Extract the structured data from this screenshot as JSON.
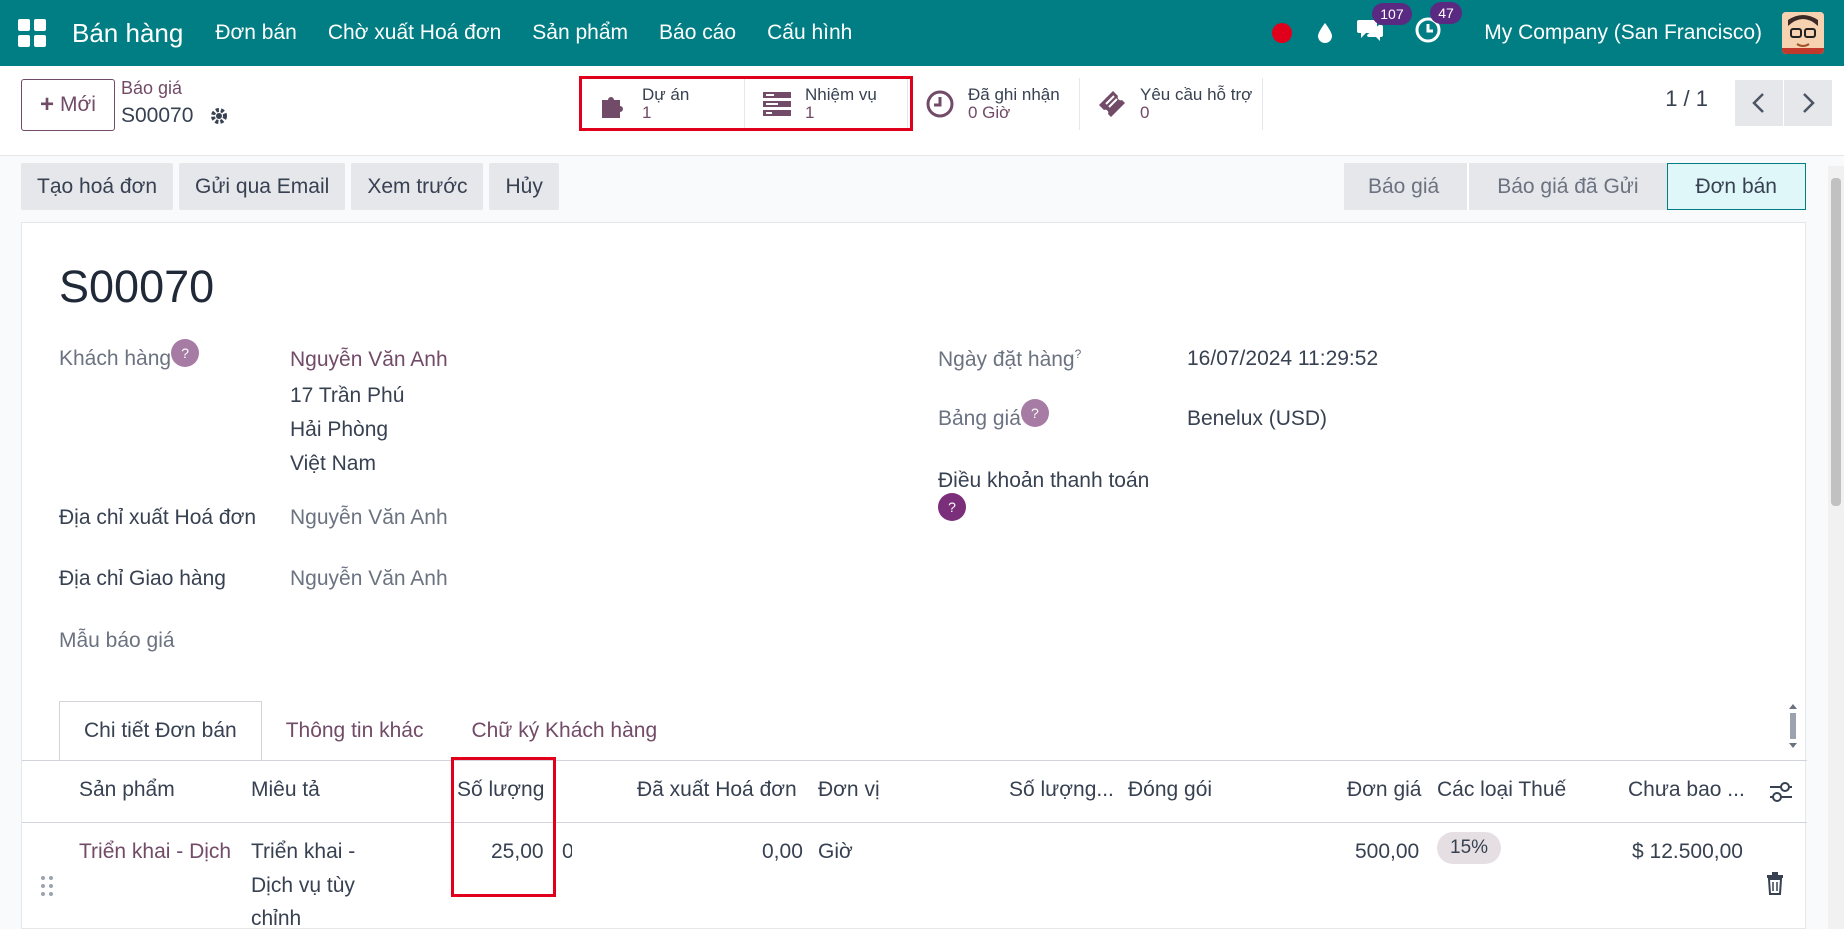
{
  "nav": {
    "app_name": "Bán hàng",
    "menu": [
      "Đơn bán",
      "Chờ xuất Hoá đơn",
      "Sản phẩm",
      "Báo cáo",
      "Cấu hình"
    ],
    "messages_count": "107",
    "activities_count": "47",
    "company": "My Company (San Francisco)"
  },
  "control": {
    "new_label": "Mới",
    "breadcrumb_parent": "Báo giá",
    "breadcrumb_current": "S00070",
    "pager": "1 / 1"
  },
  "smart_buttons": [
    {
      "label": "Dự án",
      "value": "1",
      "icon": "puzzle-icon"
    },
    {
      "label": "Nhiệm vụ",
      "value": "1",
      "icon": "tasks-icon"
    },
    {
      "label": "Đã ghi nhận",
      "value": "0 Giờ",
      "icon": "clock-icon"
    },
    {
      "label": "Yêu cầu hỗ trợ",
      "value": "0",
      "icon": "ticket-icon"
    }
  ],
  "actions": [
    "Tạo hoá đơn",
    "Gửi qua Email",
    "Xem trước",
    "Hủy"
  ],
  "stages": [
    "Báo giá",
    "Báo giá đã Gửi",
    "Đơn bán"
  ],
  "form": {
    "name": "S00070",
    "customer_label": "Khách hàng",
    "customer_name": "Nguyễn Văn Anh",
    "customer_address": [
      "17 Trần Phú",
      "Hải Phòng",
      "Việt Nam"
    ],
    "invoice_address_label": "Địa chỉ xuất Hoá đơn",
    "invoice_address": "Nguyễn Văn Anh",
    "delivery_address_label": "Địa chỉ Giao hàng",
    "delivery_address": "Nguyễn Văn Anh",
    "template_label": "Mẫu báo giá",
    "order_date_label": "Ngày đặt hàng",
    "order_date_sup": "?",
    "order_date": "16/07/2024 11:29:52",
    "pricelist_label": "Bảng giá",
    "pricelist": "Benelux (USD)",
    "payment_terms_label": "Điều khoản thanh toán",
    "help_glyph": "?"
  },
  "tabs": [
    "Chi tiết Đơn bán",
    "Thông tin khác",
    "Chữ ký Khách hàng"
  ],
  "table": {
    "headers": [
      "Sản phẩm",
      "Miêu tả",
      "Số lượng",
      "Đã xuất Hoá đơn",
      "Đơn vị",
      "Số lượng...",
      "Đóng gói",
      "Đơn giá",
      "Các loại Thuế",
      "Chưa bao ..."
    ],
    "row": {
      "product": "Triển khai - Dịch",
      "description": [
        "Triển khai -",
        "Dịch vụ tùy",
        "chỉnh"
      ],
      "quantity": "25,00",
      "delivered_clip": "0",
      "invoiced": "0,00",
      "uom": "Giờ",
      "unit_price": "500,00",
      "tax": "15%",
      "subtotal": "$ 12.500,00"
    }
  },
  "colors": {
    "navbar": "#017e84",
    "primary": "#714b67",
    "highlight": "#e0001b"
  }
}
